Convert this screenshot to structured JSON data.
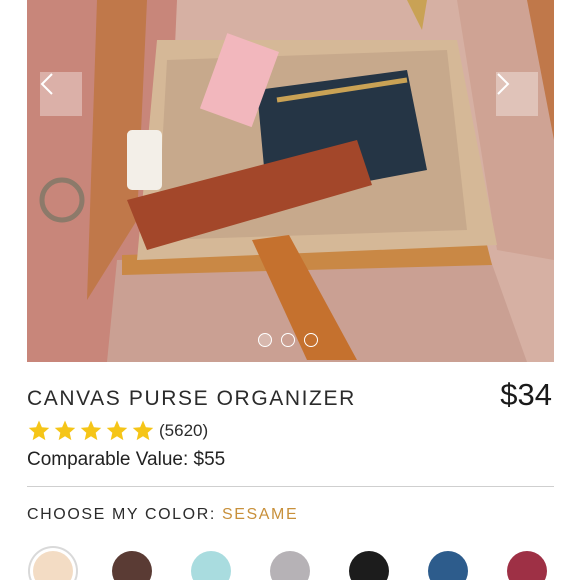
{
  "product": {
    "title": "CANVAS PURSE ORGANIZER",
    "price": "$34",
    "rating": 5,
    "review_count": "(5620)",
    "comparable_value": "Comparable Value: $55"
  },
  "gallery": {
    "slide_count": 3,
    "active_slide": 1,
    "image_label": "purse-organizer-inside-tote-photo"
  },
  "color_picker": {
    "label": "CHOOSE MY COLOR:",
    "selected": "SESAME",
    "swatches": [
      {
        "name": "sesame",
        "color": "#f3dcc4"
      },
      {
        "name": "brown",
        "color": "#5a3b34"
      },
      {
        "name": "aqua",
        "color": "#a9dcdf"
      },
      {
        "name": "gray",
        "color": "#b6b2b6"
      },
      {
        "name": "black",
        "color": "#1c1c1c"
      },
      {
        "name": "navy",
        "color": "#2d5c8c"
      },
      {
        "name": "burgundy",
        "color": "#9e3045"
      }
    ]
  },
  "colors": {
    "star": "#f5c518",
    "accent": "#c8903a"
  }
}
